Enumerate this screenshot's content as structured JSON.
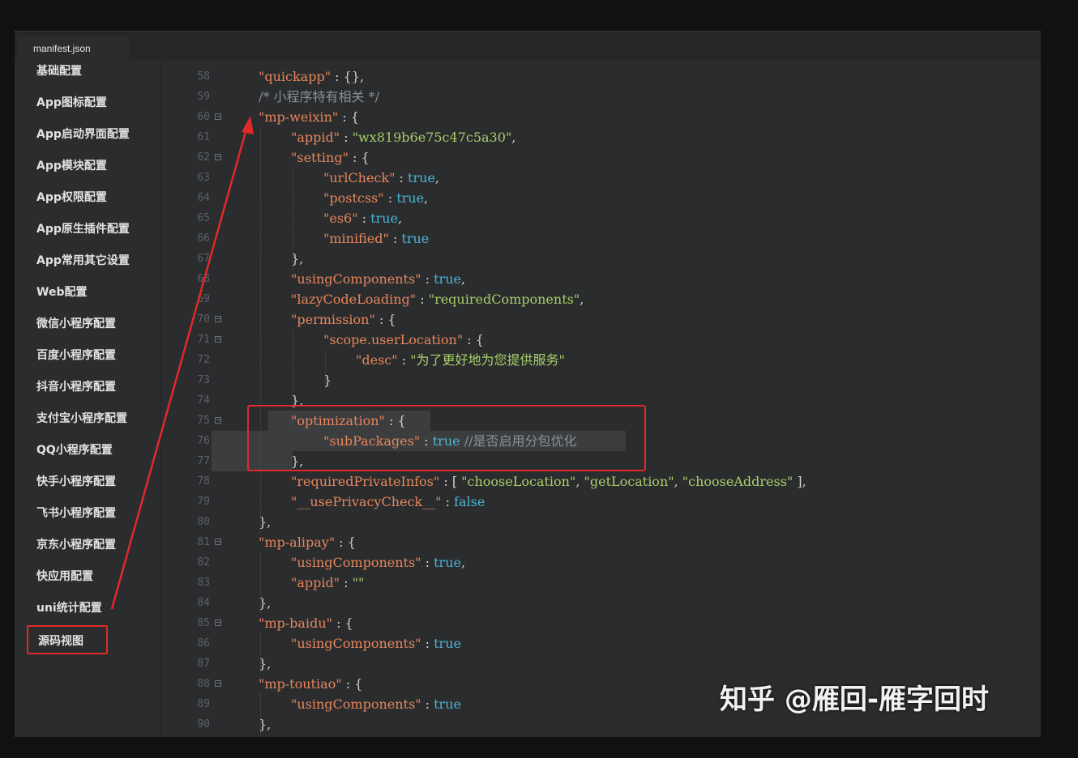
{
  "tab": {
    "label": "manifest.json"
  },
  "sidebar": {
    "items": [
      "基础配置",
      "App图标配置",
      "App启动界面配置",
      "App模块配置",
      "App权限配置",
      "App原生插件配置",
      "App常用其它设置",
      "Web配置",
      "微信小程序配置",
      "百度小程序配置",
      "抖音小程序配置",
      "支付宝小程序配置",
      "QQ小程序配置",
      "快手小程序配置",
      "飞书小程序配置",
      "京东小程序配置",
      "快应用配置",
      "uni统计配置",
      "源码视图"
    ],
    "selected": "源码视图"
  },
  "editor": {
    "lines": [
      {
        "n": "58",
        "fold": false,
        "indent": 1,
        "tokens": [
          [
            "k",
            "\"quickapp\""
          ],
          [
            "p",
            " : {},"
          ]
        ]
      },
      {
        "n": "59",
        "fold": false,
        "indent": 1,
        "tokens": [
          [
            "c",
            "/* 小程序特有相关 */"
          ]
        ]
      },
      {
        "n": "60",
        "fold": true,
        "indent": 1,
        "tokens": [
          [
            "k",
            "\"mp-weixin\""
          ],
          [
            "p",
            " : {"
          ]
        ]
      },
      {
        "n": "61",
        "fold": false,
        "indent": 2,
        "tokens": [
          [
            "k",
            "\"appid\""
          ],
          [
            "p",
            " : "
          ],
          [
            "s",
            "\"wx819b6e75c47c5a30\""
          ],
          [
            "p",
            ","
          ]
        ]
      },
      {
        "n": "62",
        "fold": true,
        "indent": 2,
        "tokens": [
          [
            "k",
            "\"setting\""
          ],
          [
            "p",
            " : {"
          ]
        ]
      },
      {
        "n": "63",
        "fold": false,
        "indent": 3,
        "tokens": [
          [
            "k",
            "\"urlCheck\""
          ],
          [
            "p",
            " : "
          ],
          [
            "b",
            "true"
          ],
          [
            "p",
            ","
          ]
        ]
      },
      {
        "n": "64",
        "fold": false,
        "indent": 3,
        "tokens": [
          [
            "k",
            "\"postcss\""
          ],
          [
            "p",
            " : "
          ],
          [
            "b",
            "true"
          ],
          [
            "p",
            ","
          ]
        ]
      },
      {
        "n": "65",
        "fold": false,
        "indent": 3,
        "tokens": [
          [
            "k",
            "\"es6\""
          ],
          [
            "p",
            " : "
          ],
          [
            "b",
            "true"
          ],
          [
            "p",
            ","
          ]
        ]
      },
      {
        "n": "66",
        "fold": false,
        "indent": 3,
        "tokens": [
          [
            "k",
            "\"minified\""
          ],
          [
            "p",
            " : "
          ],
          [
            "b",
            "true"
          ]
        ]
      },
      {
        "n": "67",
        "fold": false,
        "indent": 2,
        "tokens": [
          [
            "p",
            "},"
          ]
        ]
      },
      {
        "n": "68",
        "fold": false,
        "indent": 2,
        "tokens": [
          [
            "k",
            "\"usingComponents\""
          ],
          [
            "p",
            " : "
          ],
          [
            "b",
            "true"
          ],
          [
            "p",
            ","
          ]
        ]
      },
      {
        "n": "69",
        "fold": false,
        "indent": 2,
        "tokens": [
          [
            "k",
            "\"lazyCodeLoading\""
          ],
          [
            "p",
            " : "
          ],
          [
            "s",
            "\"requiredComponents\""
          ],
          [
            "p",
            ","
          ]
        ]
      },
      {
        "n": "70",
        "fold": true,
        "indent": 2,
        "tokens": [
          [
            "k",
            "\"permission\""
          ],
          [
            "p",
            " : {"
          ]
        ]
      },
      {
        "n": "71",
        "fold": true,
        "indent": 3,
        "tokens": [
          [
            "k",
            "\"scope.userLocation\""
          ],
          [
            "p",
            " : {"
          ]
        ]
      },
      {
        "n": "72",
        "fold": false,
        "indent": 4,
        "tokens": [
          [
            "k",
            "\"desc\""
          ],
          [
            "p",
            " : "
          ],
          [
            "s",
            "\"为了更好地为您提供服务\""
          ]
        ]
      },
      {
        "n": "73",
        "fold": false,
        "indent": 3,
        "tokens": [
          [
            "p",
            "}"
          ]
        ]
      },
      {
        "n": "74",
        "fold": false,
        "indent": 2,
        "tokens": [
          [
            "p",
            "},"
          ]
        ]
      },
      {
        "n": "75",
        "fold": true,
        "indent": 2,
        "tokens": [
          [
            "k",
            "\"optimization\""
          ],
          [
            "p",
            " : {"
          ]
        ]
      },
      {
        "n": "76",
        "fold": false,
        "indent": 3,
        "tokens": [
          [
            "k",
            "\"subPackages\""
          ],
          [
            "p",
            " : "
          ],
          [
            "b",
            "true"
          ],
          [
            "c",
            " //是否启用分包优化"
          ]
        ]
      },
      {
        "n": "77",
        "fold": false,
        "indent": 2,
        "tokens": [
          [
            "p",
            "},"
          ]
        ]
      },
      {
        "n": "78",
        "fold": false,
        "indent": 2,
        "tokens": [
          [
            "k",
            "\"requiredPrivateInfos\""
          ],
          [
            "p",
            " : [ "
          ],
          [
            "s",
            "\"chooseLocation\""
          ],
          [
            "p",
            ", "
          ],
          [
            "s",
            "\"getLocation\""
          ],
          [
            "p",
            ", "
          ],
          [
            "s",
            "\"chooseAddress\""
          ],
          [
            "p",
            " ],"
          ]
        ]
      },
      {
        "n": "79",
        "fold": false,
        "indent": 2,
        "tokens": [
          [
            "k",
            "\"__usePrivacyCheck__\""
          ],
          [
            "p",
            " : "
          ],
          [
            "b",
            "false"
          ]
        ]
      },
      {
        "n": "80",
        "fold": false,
        "indent": 1,
        "tokens": [
          [
            "p",
            "},"
          ]
        ]
      },
      {
        "n": "81",
        "fold": true,
        "indent": 1,
        "tokens": [
          [
            "k",
            "\"mp-alipay\""
          ],
          [
            "p",
            " : {"
          ]
        ]
      },
      {
        "n": "82",
        "fold": false,
        "indent": 2,
        "tokens": [
          [
            "k",
            "\"usingComponents\""
          ],
          [
            "p",
            " : "
          ],
          [
            "b",
            "true"
          ],
          [
            "p",
            ","
          ]
        ]
      },
      {
        "n": "83",
        "fold": false,
        "indent": 2,
        "tokens": [
          [
            "k",
            "\"appid\""
          ],
          [
            "p",
            " : "
          ],
          [
            "s",
            "\"\""
          ]
        ]
      },
      {
        "n": "84",
        "fold": false,
        "indent": 1,
        "tokens": [
          [
            "p",
            "},"
          ]
        ]
      },
      {
        "n": "85",
        "fold": true,
        "indent": 1,
        "tokens": [
          [
            "k",
            "\"mp-baidu\""
          ],
          [
            "p",
            " : {"
          ]
        ]
      },
      {
        "n": "86",
        "fold": false,
        "indent": 2,
        "tokens": [
          [
            "k",
            "\"usingComponents\""
          ],
          [
            "p",
            " : "
          ],
          [
            "b",
            "true"
          ]
        ]
      },
      {
        "n": "87",
        "fold": false,
        "indent": 1,
        "tokens": [
          [
            "p",
            "},"
          ]
        ]
      },
      {
        "n": "88",
        "fold": true,
        "indent": 1,
        "tokens": [
          [
            "k",
            "\"mp-toutiao\""
          ],
          [
            "p",
            " : {"
          ]
        ]
      },
      {
        "n": "89",
        "fold": false,
        "indent": 2,
        "tokens": [
          [
            "k",
            "\"usingComponents\""
          ],
          [
            "p",
            " : "
          ],
          [
            "b",
            "true"
          ]
        ]
      },
      {
        "n": "90",
        "fold": false,
        "indent": 1,
        "tokens": [
          [
            "p",
            "},"
          ]
        ]
      }
    ]
  },
  "watermark": "知乎 @雁回-雁字回时",
  "colors": {
    "accent_red": "#e02a2a",
    "key": "#e6865c",
    "string": "#a7cf6a",
    "boolean": "#4bb5d6",
    "comment": "#8a8f94"
  }
}
